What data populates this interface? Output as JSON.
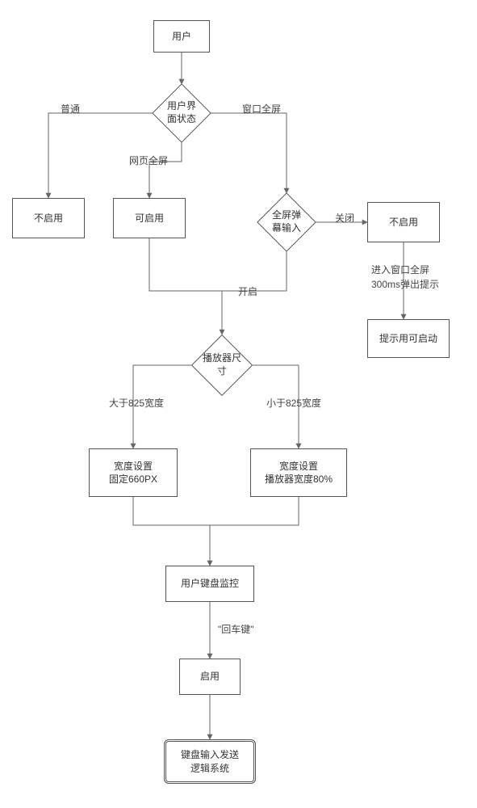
{
  "chart_data": {
    "type": "flowchart",
    "nodes": [
      {
        "id": "user",
        "shape": "rect",
        "label": "用户"
      },
      {
        "id": "ui_state",
        "shape": "diamond",
        "label": "用户界面状态"
      },
      {
        "id": "disable1",
        "shape": "rect",
        "label": "不启用"
      },
      {
        "id": "enable_ok",
        "shape": "rect",
        "label": "可启用"
      },
      {
        "id": "danmu_input",
        "shape": "diamond",
        "label": "全屏弹幕输入"
      },
      {
        "id": "disable2",
        "shape": "rect",
        "label": "不启用"
      },
      {
        "id": "popup_hint",
        "shape": "rect",
        "label": "提示用可启动"
      },
      {
        "id": "player_size",
        "shape": "diamond",
        "label": "播放器尺寸"
      },
      {
        "id": "fixed660",
        "shape": "rect",
        "label": "宽度设置\n固定660PX"
      },
      {
        "id": "pct80",
        "shape": "rect",
        "label": "宽度设置\n播放器宽度80%"
      },
      {
        "id": "kb_monitor",
        "shape": "rect",
        "label": "用户键盘监控"
      },
      {
        "id": "activate",
        "shape": "rect",
        "label": "启用"
      },
      {
        "id": "logic_sys",
        "shape": "rect-db",
        "label": "键盘输入发送\n逻辑系统"
      }
    ],
    "edges": [
      {
        "from": "user",
        "to": "ui_state",
        "label": ""
      },
      {
        "from": "ui_state",
        "to": "disable1",
        "label": "普通"
      },
      {
        "from": "ui_state",
        "to": "enable_ok",
        "label": "网页全屏"
      },
      {
        "from": "ui_state",
        "to": "danmu_input",
        "label": "窗口全屏"
      },
      {
        "from": "danmu_input",
        "to": "disable2",
        "label": "关闭"
      },
      {
        "from": "disable2",
        "to": "popup_hint",
        "label": "进入窗口全屏\n300ms弹出提示"
      },
      {
        "from": "danmu_input",
        "to": "player_size",
        "label": "开启"
      },
      {
        "from": "enable_ok",
        "to": "player_size",
        "label": ""
      },
      {
        "from": "player_size",
        "to": "fixed660",
        "label": "大于825宽度"
      },
      {
        "from": "player_size",
        "to": "pct80",
        "label": "小于825宽度"
      },
      {
        "from": "fixed660",
        "to": "kb_monitor",
        "label": ""
      },
      {
        "from": "pct80",
        "to": "kb_monitor",
        "label": ""
      },
      {
        "from": "kb_monitor",
        "to": "activate",
        "label": "\"回车键\""
      },
      {
        "from": "activate",
        "to": "logic_sys",
        "label": ""
      }
    ]
  },
  "nodes": {
    "user": "用户",
    "ui_state": "用户界面状态",
    "disable1": "不启用",
    "enable_ok": "可启用",
    "danmu_input": "全屏弹幕输入",
    "disable2": "不启用",
    "popup_hint": "提示用可启动",
    "player_size": "播放器尺寸",
    "fixed660_l1": "宽度设置",
    "fixed660_l2": "固定660PX",
    "pct80_l1": "宽度设置",
    "pct80_l2": "播放器宽度80%",
    "kb_monitor": "用户键盘监控",
    "activate": "启用",
    "logic_sys_l1": "键盘输入发送",
    "logic_sys_l2": "逻辑系统"
  },
  "edges": {
    "normal": "普通",
    "web_fs": "网页全屏",
    "win_fs": "窗口全屏",
    "close": "关闭",
    "open": "开启",
    "hint1": "进入窗口全屏",
    "hint2": "300ms弹出提示",
    "gt825": "大于825宽度",
    "lt825": "小于825宽度",
    "enter": "\"回车键\""
  }
}
